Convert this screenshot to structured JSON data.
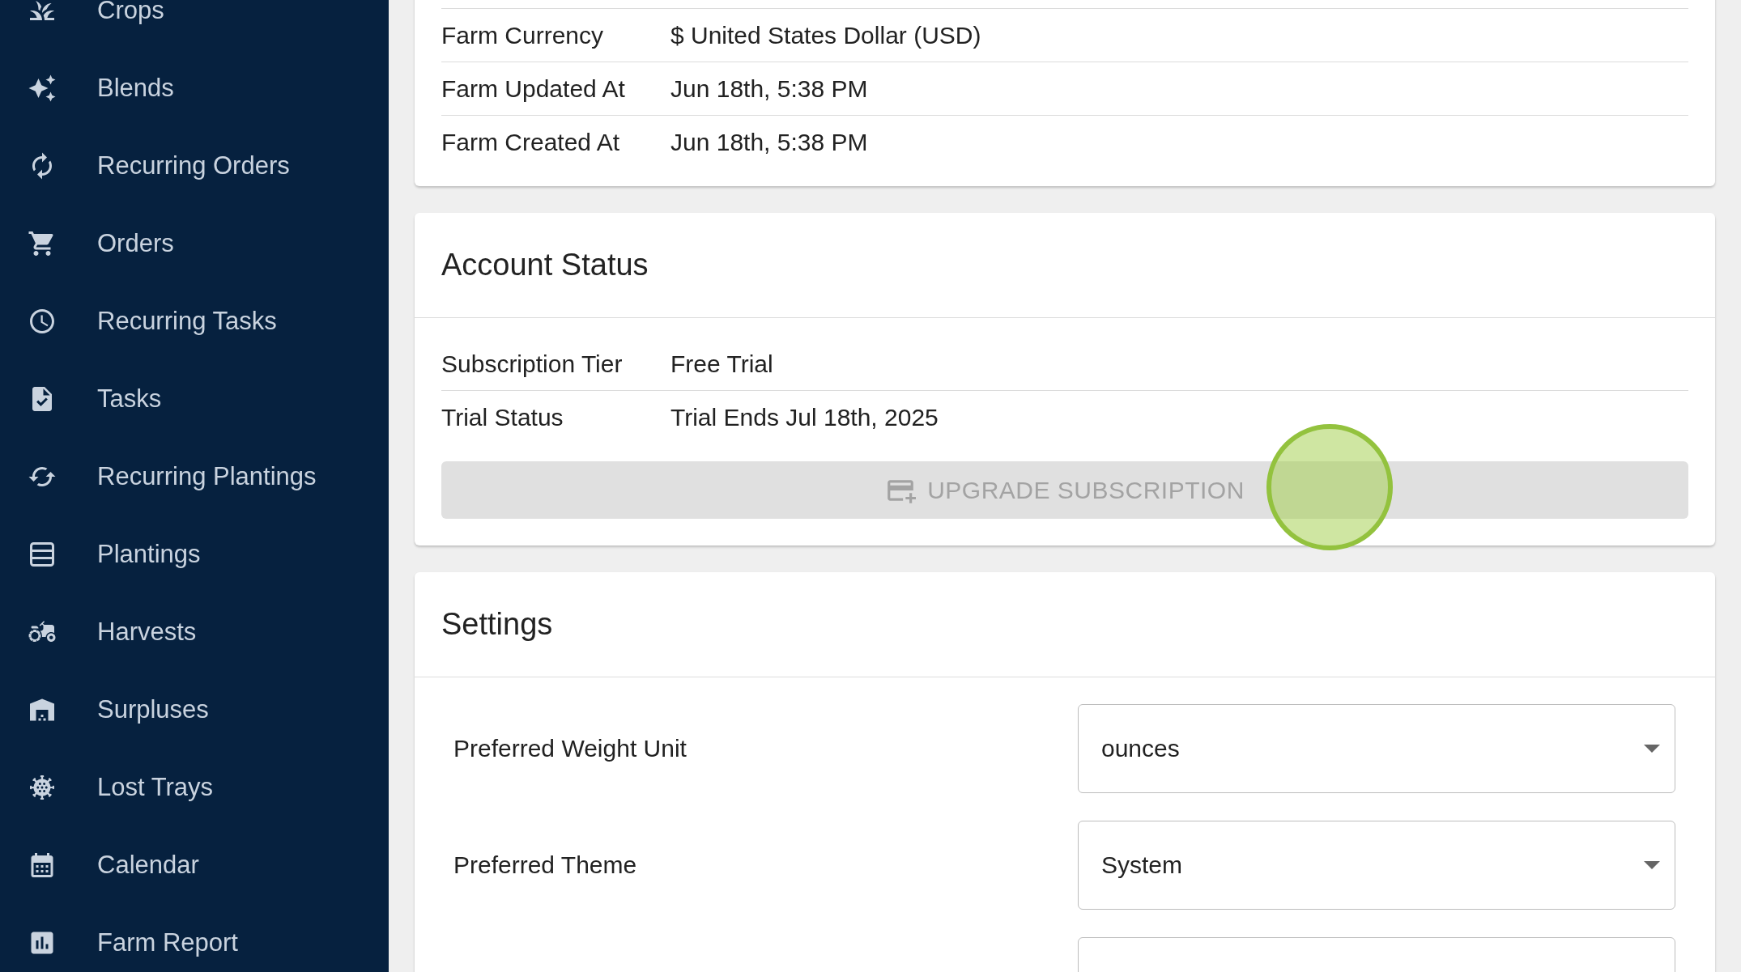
{
  "sidebar": {
    "items": [
      {
        "label": "Crops",
        "selected": false
      },
      {
        "label": "Blends",
        "selected": false
      },
      {
        "label": "Recurring Orders",
        "selected": false
      },
      {
        "label": "Orders",
        "selected": false
      },
      {
        "label": "Recurring Tasks",
        "selected": false
      },
      {
        "label": "Tasks",
        "selected": false
      },
      {
        "label": "Recurring Plantings",
        "selected": false
      },
      {
        "label": "Plantings",
        "selected": false
      },
      {
        "label": "Harvests",
        "selected": false
      },
      {
        "label": "Surpluses",
        "selected": false
      },
      {
        "label": "Lost Trays",
        "selected": false
      },
      {
        "label": "Calendar",
        "selected": false
      },
      {
        "label": "Farm Report",
        "selected": false
      }
    ]
  },
  "farm_details": {
    "rows": [
      {
        "label": "Farm Currency",
        "value": "$ United States Dollar (USD)"
      },
      {
        "label": "Farm Updated At",
        "value": "Jun 18th, 5:38 PM"
      },
      {
        "label": "Farm Created At",
        "value": "Jun 18th, 5:38 PM"
      }
    ]
  },
  "account_status": {
    "title": "Account Status",
    "rows": [
      {
        "label": "Subscription Tier",
        "value": "Free Trial"
      },
      {
        "label": "Trial Status",
        "value": "Trial Ends Jul 18th, 2025"
      }
    ],
    "button": {
      "label": "UPGRADE SUBSCRIPTION",
      "disabled": true,
      "click_highlight": true
    }
  },
  "settings": {
    "title": "Settings",
    "fields": [
      {
        "kind": "select",
        "label": "Preferred Weight Unit",
        "value": "ounces"
      },
      {
        "kind": "select",
        "label": "Preferred Theme",
        "value": "System"
      },
      {
        "kind": "blank"
      }
    ]
  }
}
